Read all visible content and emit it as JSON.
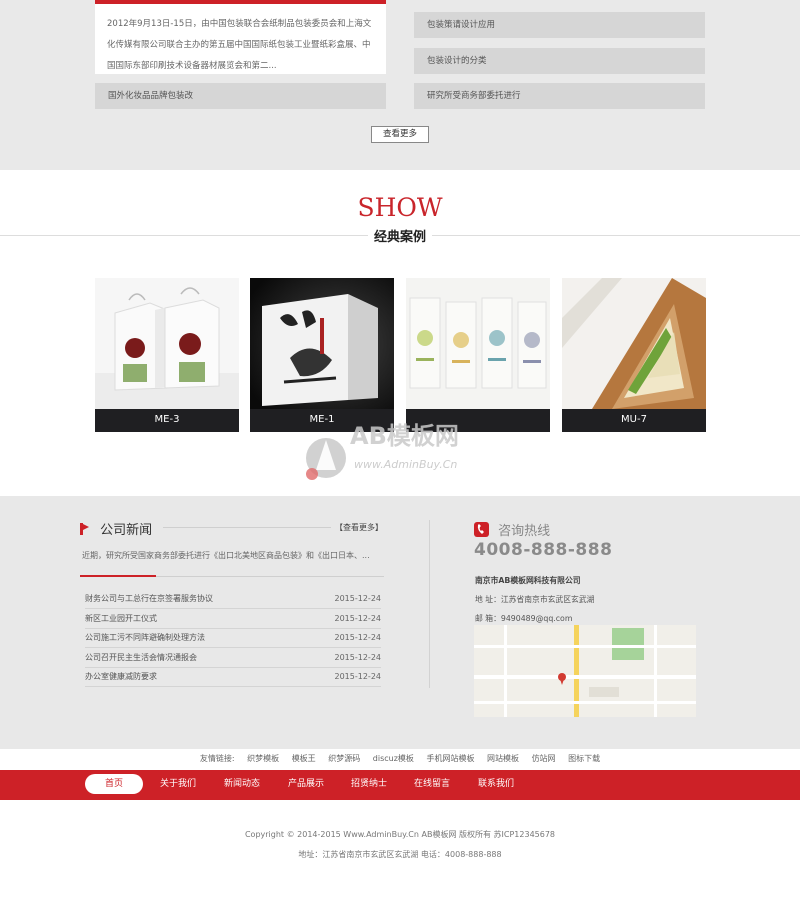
{
  "top_news": {
    "featured_text": "2012年9月13日-15日，由中国包装联合会纸制品包装委员会和上海文化传媒有限公司联合主办的第五届中国国际纸包装工业暨纸彩盒展、中国国际东部印刷技术设备器材展览会和第二...",
    "left_items": [
      "国外化妆品品牌包装改"
    ],
    "right_items": [
      "包装策请设计应用",
      "包装设计的分类",
      "研究所受商务部委托进行"
    ],
    "more_label": "查看更多"
  },
  "show": {
    "title": "SHOW",
    "subtitle": "经典案例",
    "cases": [
      {
        "label": "ME-3",
        "icon": "rice-box-image"
      },
      {
        "label": "ME-1",
        "icon": "calligraphy-bag-image"
      },
      {
        "label": "",
        "icon": "cosmetic-boxes-image"
      },
      {
        "label": "MU-7",
        "icon": "sandwich-box-image"
      }
    ]
  },
  "watermark": {
    "logo": "AB模板网",
    "site": "www.AdminBuy.Cn"
  },
  "company_news": {
    "title": "公司新闻",
    "more_label": "【查看更多】",
    "lead": "近期，研究所受国家商务部委托进行《出口北美地区商品包装》和《出口日本、...",
    "items": [
      {
        "title": "财务公司与工总行在京签署服务协议",
        "date": "2015-12-24"
      },
      {
        "title": "新区工业园开工仪式",
        "date": "2015-12-24"
      },
      {
        "title": "公司施工污不同阵避确制处理方法",
        "date": "2015-12-24"
      },
      {
        "title": "公司召开民主生活会情况通报会",
        "date": "2015-12-24"
      },
      {
        "title": "办公室健康减防要求",
        "date": "2015-12-24"
      }
    ]
  },
  "contact": {
    "title": "咨询热线",
    "phone": "4008-888-888",
    "company": "南京市AB模板网科技有限公司",
    "address": "地   址：江苏省南京市玄武区玄武湖",
    "email": "邮   箱：9490489@qq.com"
  },
  "links": {
    "label": "友情链接:",
    "items": [
      "织梦模板",
      "模板王",
      "织梦源码",
      "discuz模板",
      "手机网站模板",
      "网站模板",
      "仿站网",
      "图标下载"
    ]
  },
  "nav": {
    "items": [
      "首页",
      "关于我们",
      "新闻动态",
      "产品展示",
      "招贤纳士",
      "在线留言",
      "联系我们"
    ]
  },
  "footer": {
    "copyright": "Copyright © 2014-2015 Www.AdminBuy.Cn AB模板网 版权所有   苏ICP12345678",
    "address": "地址：江苏省南京市玄武区玄武湖   电话：4008-888-888"
  },
  "colors": {
    "accent": "#cd2127",
    "dark_caption": "#1f1f22",
    "section_bg": "#e8e8e8"
  }
}
